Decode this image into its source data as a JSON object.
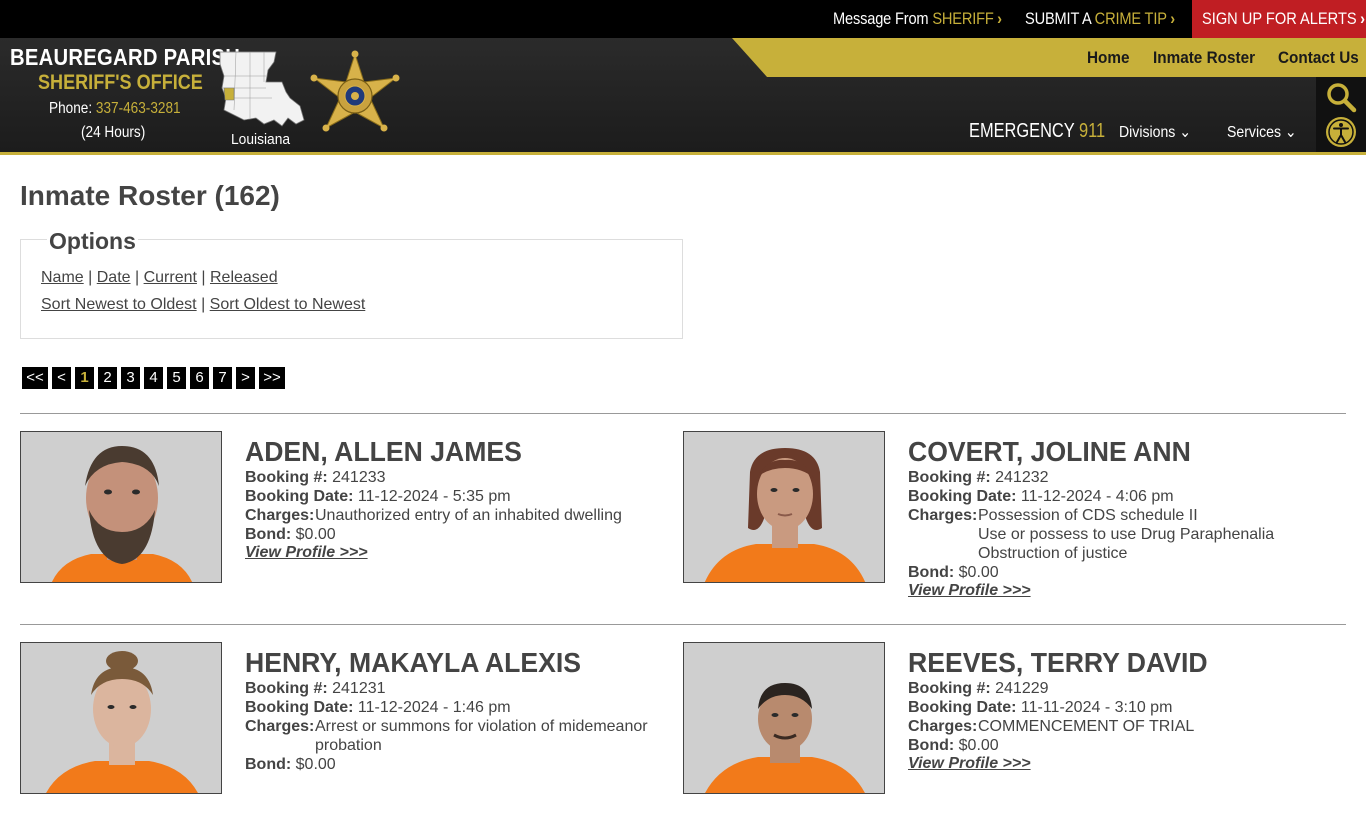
{
  "topbar": {
    "message_prefix": "Message From ",
    "message_accent": "SHERIFF",
    "tip_prefix": "SUBMIT A ",
    "tip_accent": "CRIME TIP",
    "alerts": "SIGN UP FOR ALERTS",
    "chevron": "›"
  },
  "brand": {
    "name": "BEAUREGARD PARISH",
    "sub": "SHERIFF'S OFFICE",
    "phone_label": "Phone: ",
    "phone": "337-463-3281",
    "hours": "(24 Hours)",
    "state": "Louisiana"
  },
  "nav": {
    "home": "Home",
    "roster": "Inmate Roster",
    "contact": "Contact Us",
    "emergency_label": "EMERGENCY ",
    "emergency_number": "911",
    "divisions": "Divisions ⌄",
    "services": "Services ⌄"
  },
  "page": {
    "title": "Inmate Roster (162)"
  },
  "options": {
    "legend": "Options",
    "name": "Name",
    "date": "Date",
    "current": "Current",
    "released": "Released",
    "sep": " | ",
    "newest": "Sort Newest to Oldest",
    "oldest": "Sort Oldest to Newest"
  },
  "pager": [
    "<<",
    "<",
    "1",
    "2",
    "3",
    "4",
    "5",
    "6",
    "7",
    ">",
    ">>"
  ],
  "labels": {
    "booking_no": "Booking #:",
    "booking_date": "Booking Date:",
    "charges": "Charges:",
    "bond": "Bond:",
    "view": "View Profile >>>"
  },
  "inmates": [
    {
      "name": "ADEN, ALLEN JAMES",
      "booking_no": "241233",
      "booking_date": "11-12-2024 - 5:35 pm",
      "charges": [
        "Unauthorized entry of an inhabited dwelling"
      ],
      "bond": "$0.00"
    },
    {
      "name": "COVERT, JOLINE ANN",
      "booking_no": "241232",
      "booking_date": "11-12-2024 - 4:06 pm",
      "charges": [
        "Possession of CDS schedule II",
        "Use or possess to use Drug Paraphenalia",
        "Obstruction of justice"
      ],
      "bond": "$0.00"
    },
    {
      "name": "HENRY, MAKAYLA ALEXIS",
      "booking_no": "241231",
      "booking_date": "11-12-2024 - 1:46 pm",
      "charges": [
        "Arrest or summons for violation of midemeanor",
        "probation"
      ],
      "bond": "$0.00"
    },
    {
      "name": "REEVES, TERRY DAVID",
      "booking_no": "241229",
      "booking_date": "11-11-2024 - 3:10 pm",
      "charges": [
        "COMMENCEMENT OF TRIAL"
      ],
      "bond": "$0.00"
    }
  ],
  "colors": {
    "gold": "#c7b03a",
    "alert_red": "#c01e23",
    "uniform_orange": "#f27a1a"
  }
}
